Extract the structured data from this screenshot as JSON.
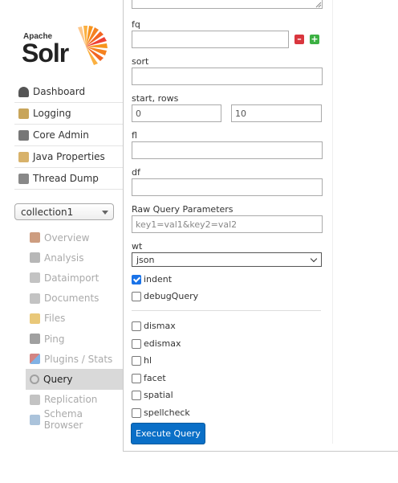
{
  "logo": {
    "apache": "Apache",
    "solr": "Solr"
  },
  "nav": [
    {
      "label": "Dashboard",
      "icon": "dashboard-icon",
      "color": "#555555"
    },
    {
      "label": "Logging",
      "icon": "logging-icon",
      "color": "#c8a55a"
    },
    {
      "label": "Core Admin",
      "icon": "core-admin-icon",
      "color": "#777777"
    },
    {
      "label": "Java Properties",
      "icon": "java-properties-icon",
      "color": "#d8b26a"
    },
    {
      "label": "Thread Dump",
      "icon": "thread-dump-icon",
      "color": "#888888"
    }
  ],
  "core_selector": {
    "value": "collection1"
  },
  "core_menu": [
    {
      "label": "Overview",
      "icon": "home-icon",
      "color": "#b8734a",
      "active": false
    },
    {
      "label": "Analysis",
      "icon": "funnel-icon",
      "color": "#999999",
      "active": false
    },
    {
      "label": "Dataimport",
      "icon": "dataimport-icon",
      "color": "#aaaaaa",
      "active": false
    },
    {
      "label": "Documents",
      "icon": "documents-icon",
      "color": "#aaaaaa",
      "active": false
    },
    {
      "label": "Files",
      "icon": "folder-icon",
      "color": "#e0b040",
      "active": false
    },
    {
      "label": "Ping",
      "icon": "ping-icon",
      "color": "#777777",
      "active": false
    },
    {
      "label": "Plugins / Stats",
      "icon": "plugins-icon",
      "color": "#c0504d",
      "active": false
    },
    {
      "label": "Query",
      "icon": "magnifier-icon",
      "color": "#888888",
      "active": true
    },
    {
      "label": "Replication",
      "icon": "replication-icon",
      "color": "#aaaaaa",
      "active": false
    },
    {
      "label": "Schema Browser",
      "icon": "schema-browser-icon",
      "color": "#88aacc",
      "active": false
    }
  ],
  "query_form": {
    "fq_label": "fq",
    "fq_value": "",
    "sort_label": "sort",
    "sort_value": "",
    "start_rows_label": "start, rows",
    "start_value": "0",
    "rows_value": "10",
    "fl_label": "fl",
    "fl_value": "",
    "df_label": "df",
    "df_value": "",
    "raw_label": "Raw Query Parameters",
    "raw_placeholder": "key1=val1&key2=val2",
    "wt_label": "wt",
    "wt_value": "json",
    "checkboxes": [
      {
        "label": "indent",
        "checked": true
      },
      {
        "label": "debugQuery",
        "checked": false
      },
      {
        "label": "dismax",
        "checked": false
      },
      {
        "label": "edismax",
        "checked": false
      },
      {
        "label": "hl",
        "checked": false
      },
      {
        "label": "facet",
        "checked": false
      },
      {
        "label": "spatial",
        "checked": false
      },
      {
        "label": "spellcheck",
        "checked": false
      }
    ],
    "execute_label": "Execute Query",
    "accent": "#0a6fc7",
    "remove_color": "#d9363e",
    "add_color": "#3cb043"
  }
}
